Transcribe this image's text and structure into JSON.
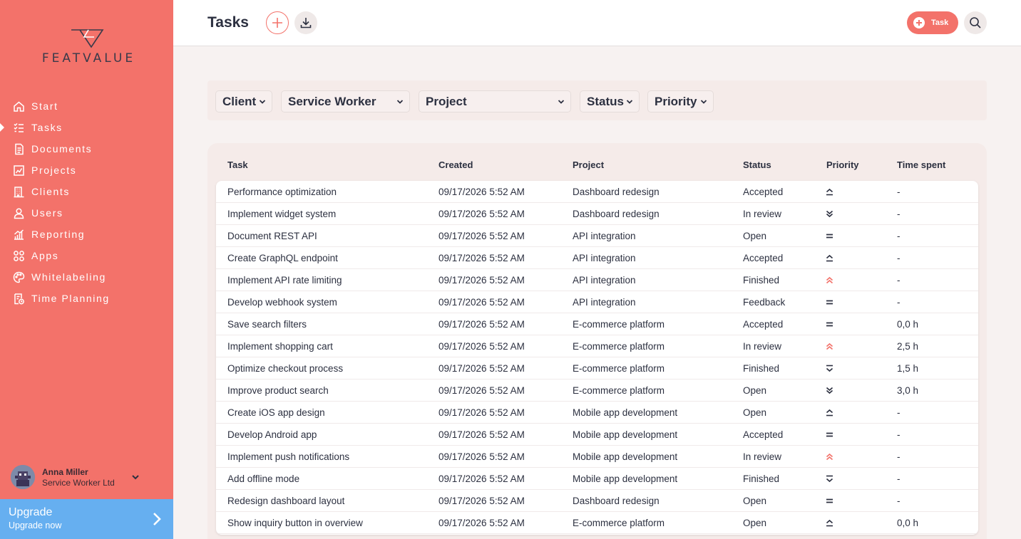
{
  "brand": {
    "logo_text": "FEATVALUE"
  },
  "nav": [
    {
      "label": "Start",
      "icon": "home-icon"
    },
    {
      "label": "Tasks",
      "icon": "tasks-icon",
      "active": true
    },
    {
      "label": "Documents",
      "icon": "documents-icon"
    },
    {
      "label": "Projects",
      "icon": "projects-icon"
    },
    {
      "label": "Clients",
      "icon": "clients-icon"
    },
    {
      "label": "Users",
      "icon": "users-icon"
    },
    {
      "label": "Reporting",
      "icon": "reporting-icon"
    },
    {
      "label": "Apps",
      "icon": "apps-icon"
    },
    {
      "label": "Whitelabeling",
      "icon": "whitelabeling-icon"
    },
    {
      "label": "Time Planning",
      "icon": "time-planning-icon"
    }
  ],
  "user": {
    "name": "Anna Miller",
    "org": "Service Worker Ltd"
  },
  "upgrade": {
    "title": "Upgrade",
    "subtitle": "Upgrade now"
  },
  "header": {
    "title": "Tasks",
    "task_button": "Task"
  },
  "filters": [
    "Client",
    "Service Worker",
    "Project",
    "Status",
    "Priority"
  ],
  "table": {
    "columns": [
      "Task",
      "Created",
      "Project",
      "Status",
      "Priority",
      "Time spent"
    ],
    "rows": [
      {
        "task": "Performance optimization",
        "created": "09/17/2026 5:52 AM",
        "project": "Dashboard redesign",
        "status": "Accepted",
        "priority": "high",
        "time": "-"
      },
      {
        "task": "Implement widget system",
        "created": "09/17/2026 5:52 AM",
        "project": "Dashboard redesign",
        "status": "In review",
        "priority": "lowest",
        "time": "-"
      },
      {
        "task": "Document REST API",
        "created": "09/17/2026 5:52 AM",
        "project": "API integration",
        "status": "Open",
        "priority": "medium",
        "time": "-"
      },
      {
        "task": "Create GraphQL endpoint",
        "created": "09/17/2026 5:52 AM",
        "project": "API integration",
        "status": "Accepted",
        "priority": "high",
        "time": "-"
      },
      {
        "task": "Implement API rate limiting",
        "created": "09/17/2026 5:52 AM",
        "project": "API integration",
        "status": "Finished",
        "priority": "highest",
        "time": "-"
      },
      {
        "task": "Develop webhook system",
        "created": "09/17/2026 5:52 AM",
        "project": "API integration",
        "status": "Feedback",
        "priority": "medium",
        "time": "-"
      },
      {
        "task": "Save search filters",
        "created": "09/17/2026 5:52 AM",
        "project": "E-commerce platform",
        "status": "Accepted",
        "priority": "medium",
        "time": "0,0 h"
      },
      {
        "task": "Implement shopping cart",
        "created": "09/17/2026 5:52 AM",
        "project": "E-commerce platform",
        "status": "In review",
        "priority": "highest",
        "time": "2,5 h"
      },
      {
        "task": "Optimize checkout process",
        "created": "09/17/2026 5:52 AM",
        "project": "E-commerce platform",
        "status": "Finished",
        "priority": "low",
        "time": "1,5 h"
      },
      {
        "task": "Improve product search",
        "created": "09/17/2026 5:52 AM",
        "project": "E-commerce platform",
        "status": "Open",
        "priority": "lowest",
        "time": "3,0 h"
      },
      {
        "task": "Create iOS app design",
        "created": "09/17/2026 5:52 AM",
        "project": "Mobile app development",
        "status": "Open",
        "priority": "high",
        "time": "-"
      },
      {
        "task": "Develop Android app",
        "created": "09/17/2026 5:52 AM",
        "project": "Mobile app development",
        "status": "Accepted",
        "priority": "medium",
        "time": "-"
      },
      {
        "task": "Implement push notifications",
        "created": "09/17/2026 5:52 AM",
        "project": "Mobile app development",
        "status": "In review",
        "priority": "highest",
        "time": "-"
      },
      {
        "task": "Add offline mode",
        "created": "09/17/2026 5:52 AM",
        "project": "Mobile app development",
        "status": "Finished",
        "priority": "low",
        "time": "-"
      },
      {
        "task": "Redesign dashboard layout",
        "created": "09/17/2026 5:52 AM",
        "project": "Dashboard redesign",
        "status": "Open",
        "priority": "medium",
        "time": "-"
      },
      {
        "task": "Show inquiry button in overview",
        "created": "09/17/2026 5:52 AM",
        "project": "E-commerce platform",
        "status": "Open",
        "priority": "high",
        "time": "0,0 h"
      }
    ]
  },
  "colors": {
    "sidebar": "#f3726a",
    "accent": "#f3726a",
    "upgrade": "#66aff0",
    "highest_priority": "#f3726a"
  }
}
